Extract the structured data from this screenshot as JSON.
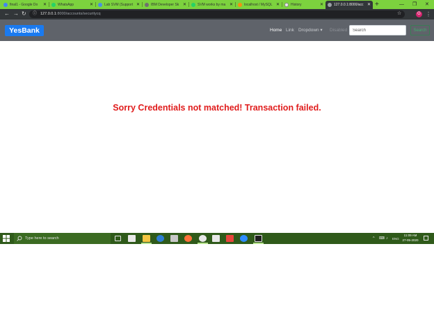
{
  "browser": {
    "tabs": [
      {
        "title": "final1 - Google Do",
        "favicon_color": "#4285f4"
      },
      {
        "title": "WhatsApp",
        "favicon_color": "#25d366"
      },
      {
        "title": "Lab SVM (Support",
        "favicon_color": "#4a90e2"
      },
      {
        "title": "IBM Developer Sk",
        "favicon_color": "#6f6f6f"
      },
      {
        "title": "SVM works by ma",
        "favicon_color": "#25d366"
      },
      {
        "title": "localhost / MySQL",
        "favicon_color": "#f29111"
      },
      {
        "title": "History",
        "favicon_color": "#e8e8e8"
      },
      {
        "title": "127.0.0.1:8000/acc",
        "favicon_color": "#9aa0a6"
      }
    ],
    "active_tab_index": 7,
    "new_tab_label": "+",
    "url_host": "127.0.0.1",
    "url_path": ":8000/accounts/securitycq",
    "profile_initial": "G",
    "controls": {
      "back": "←",
      "forward": "→",
      "reload": "↻",
      "info": "ⓘ",
      "star": "☆",
      "menu": "⋮",
      "minimize": "—",
      "maximize": "❐",
      "close": "✕"
    }
  },
  "navbar": {
    "brand": "YesBank",
    "links": {
      "home": "Home",
      "link": "Link",
      "dropdown": "Dropdown ▾",
      "disabled": "Disabled"
    },
    "search_placeholder": "Search",
    "search_button": "Search"
  },
  "main": {
    "message": "Sorry Credentials not matched! Transaction failed."
  },
  "taskbar": {
    "search_placeholder": "Type here to search",
    "tray_icons": [
      "^",
      "⌨",
      "♪",
      "ENG"
    ],
    "time": "11:09 AM",
    "date": "27-05-2020"
  },
  "colors": {
    "tab_strip": "#7cd23e",
    "navbar": "#5f636a",
    "brand_bg": "#1a7af0",
    "error_text": "#e01c1c",
    "taskbar": "#2f5a1a",
    "search_button": "#3eae6b"
  }
}
